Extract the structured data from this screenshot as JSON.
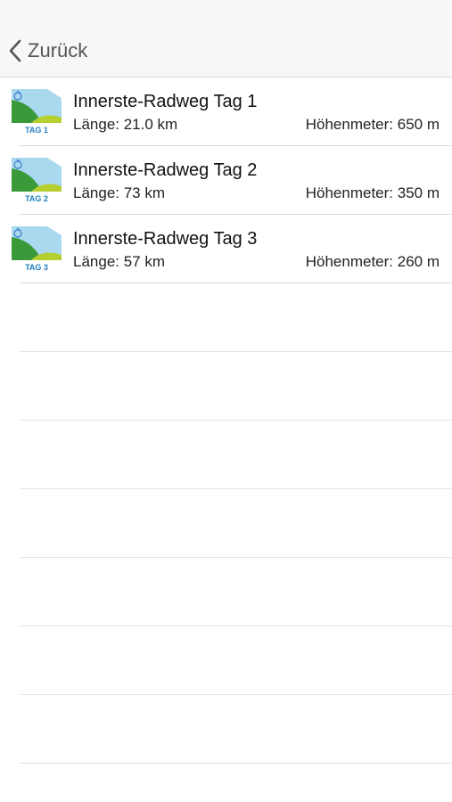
{
  "nav": {
    "back_label": "Zurück",
    "back_icon": "chevron-left-icon"
  },
  "routes": [
    {
      "title": "Innerste-Radweg Tag 1",
      "length": "Länge: 21.0 km",
      "elevation": "Höhenmeter: 650 m",
      "badge": "TAG 1"
    },
    {
      "title": "Innerste-Radweg Tag 2",
      "length": "Länge: 73 km",
      "elevation": "Höhenmeter: 350 m",
      "badge": "TAG 2"
    },
    {
      "title": "Innerste-Radweg Tag 3",
      "length": "Länge: 57 km",
      "elevation": "Höhenmeter: 260 m",
      "badge": "TAG 3"
    }
  ],
  "colors": {
    "sky": "#a9d8ef",
    "hill_dark": "#3a9a3a",
    "hill_light": "#b5cf2e",
    "badge_text": "#1f7fc0"
  }
}
